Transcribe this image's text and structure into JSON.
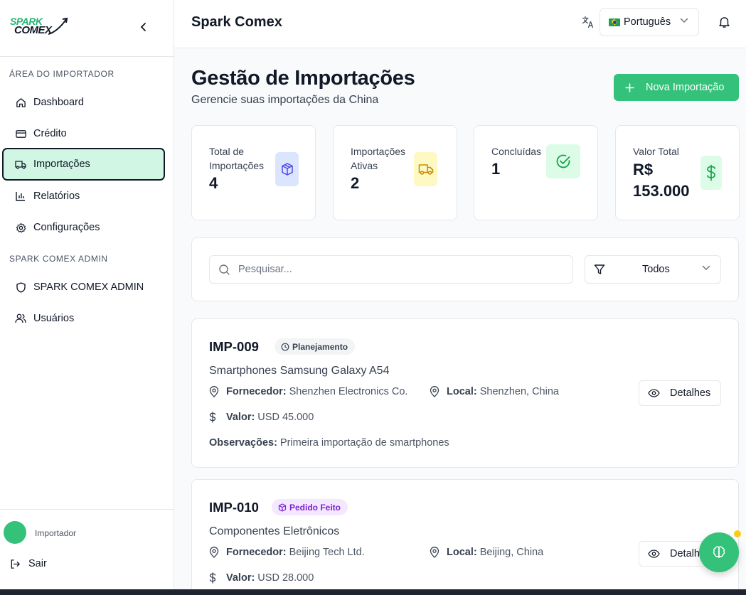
{
  "sidebar": {
    "logo": {
      "line1": "SPARK",
      "line2": "COMEX"
    },
    "section_importer": "ÁREA DO IMPORTADOR",
    "items": [
      {
        "label": "Dashboard",
        "icon": "home-icon"
      },
      {
        "label": "Crédito",
        "icon": "credit-card-icon"
      },
      {
        "label": "Importações",
        "icon": "truck-icon",
        "active": true
      },
      {
        "label": "Relatórios",
        "icon": "bar-chart-icon"
      },
      {
        "label": "Configurações",
        "icon": "gear-icon"
      }
    ],
    "section_admin": "SPARK COMEX ADMIN",
    "admin_items": [
      {
        "label": "SPARK COMEX ADMIN",
        "icon": "shield-icon"
      },
      {
        "label": "Usuários",
        "icon": "users-icon"
      }
    ],
    "footer": {
      "role": "Importador",
      "logout_label": "Sair"
    }
  },
  "header": {
    "title": "Spark Comex",
    "language": "Português"
  },
  "page": {
    "title": "Gestão de Importações",
    "subtitle": "Gerencie suas importações da China",
    "new_button": "Nova Importação"
  },
  "stats": [
    {
      "label": "Total de Importações",
      "value": "4",
      "icon": "package-icon"
    },
    {
      "label": "Importações Ativas",
      "value": "2",
      "icon": "truck-icon"
    },
    {
      "label": "Concluídas",
      "value": "1",
      "icon": "check-circle-icon"
    },
    {
      "label": "Valor Total",
      "value": "R$ 153.000",
      "icon": "dollar-icon"
    }
  ],
  "filters": {
    "search_placeholder": "Pesquisar...",
    "status_value": "Todos"
  },
  "labels": {
    "supplier": "Fornecedor:",
    "location": "Local:",
    "value": "Valor:",
    "notes": "Observações:",
    "details": "Detalhes"
  },
  "imports": [
    {
      "code": "IMP-009",
      "status": "Planejamento",
      "name": "Smartphones Samsung Galaxy A54",
      "supplier": "Shenzhen Electronics Co.",
      "location": "Shenzhen, China",
      "value": "USD 45.000",
      "notes": "Primeira importação de smartphones"
    },
    {
      "code": "IMP-010",
      "status": "Pedido Feito",
      "name": "Componentes Eletrônicos",
      "supplier": "Beijing Tech Ltd.",
      "location": "Beijing, China",
      "value": "USD 28.000"
    }
  ],
  "colors": {
    "brand": "#34c179",
    "active_nav_bg": "#d1f7e4",
    "pill_planning_bg": "#f3f4f6",
    "pill_ordered_bg": "#f3e8ff",
    "pill_ordered_text": "#7e22ce"
  }
}
